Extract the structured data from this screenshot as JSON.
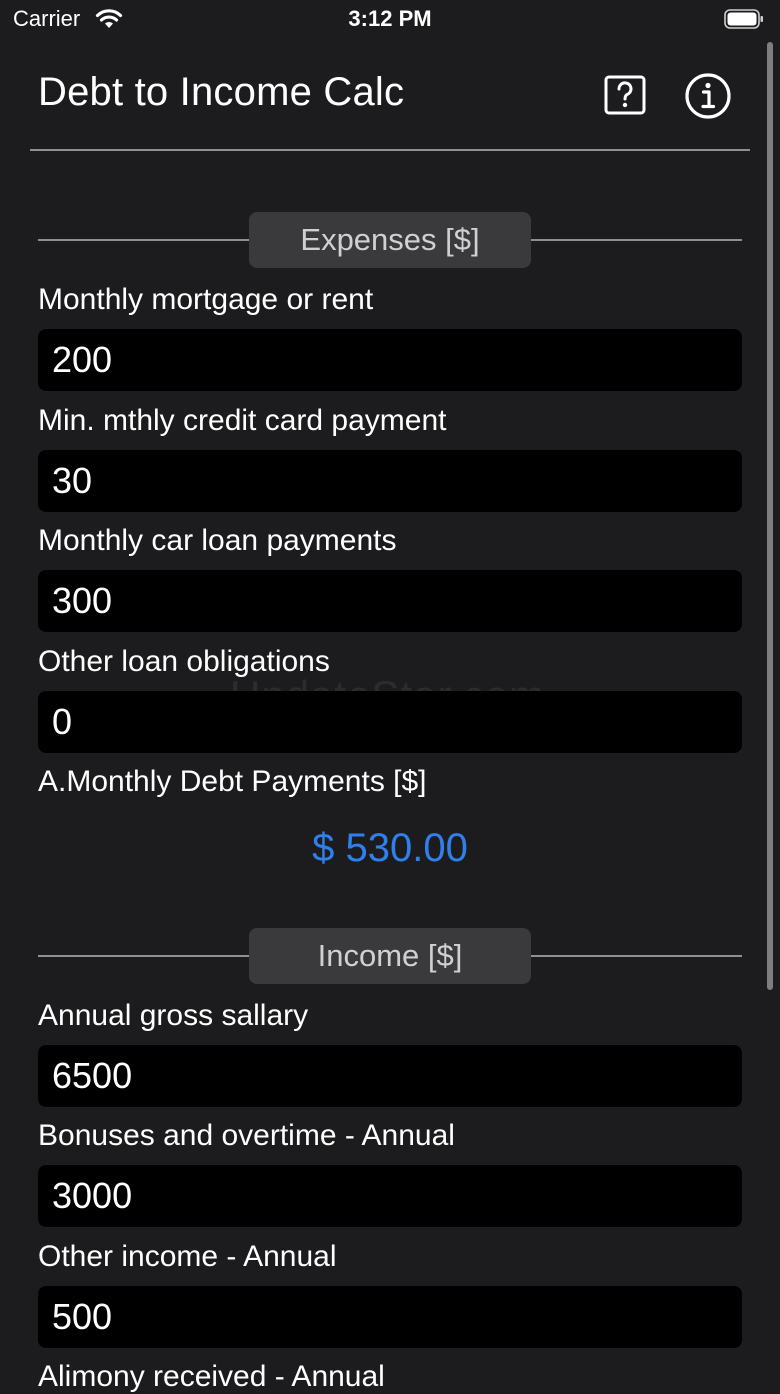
{
  "status_bar": {
    "carrier": "Carrier",
    "time": "3:12 PM",
    "wifi_icon": "wifi-icon",
    "battery_icon": "battery-icon"
  },
  "nav": {
    "title": "Debt to Income Calc",
    "help_icon": "question-square-icon",
    "info_icon": "info-circle-icon"
  },
  "expenses": {
    "header": "Expenses [$]",
    "fields": [
      {
        "label": "Monthly mortgage or rent",
        "value": "200"
      },
      {
        "label": "Min. mthly credit card payment",
        "value": "30"
      },
      {
        "label": "Monthly car loan payments",
        "value": "300"
      },
      {
        "label": "Other loan obligations",
        "value": "0"
      }
    ],
    "result_label": "A.Monthly Debt Payments [$]",
    "result_value": "$ 530.00"
  },
  "income": {
    "header": "Income [$]",
    "fields": [
      {
        "label": "Annual gross sallary",
        "value": "6500"
      },
      {
        "label": "Bonuses and overtime - Annual",
        "value": "3000"
      },
      {
        "label": "Other income - Annual",
        "value": "500"
      },
      {
        "label": "Alimony received - Annual",
        "value": ""
      }
    ]
  },
  "watermark": "UpdateStar.com",
  "colors": {
    "background": "#1c1c1e",
    "input_background": "#000000",
    "accent": "#2f80ed",
    "pill": "#3a3a3c",
    "divider": "#8e8e93"
  }
}
